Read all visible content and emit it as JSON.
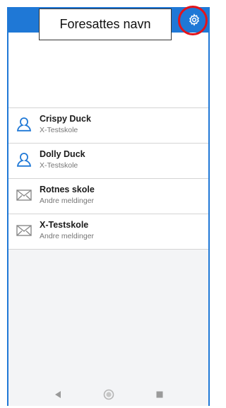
{
  "header": {
    "title": "Foresattes navn",
    "accent_color": "#1f78d6",
    "settings_icon": "gear-icon",
    "highlight_color": "#e3141b"
  },
  "conversations": [
    {
      "name": "Crispy Duck",
      "subtitle": "X-Testskole",
      "icon": "person-icon"
    },
    {
      "name": "Dolly Duck",
      "subtitle": "X-Testskole",
      "icon": "person-icon"
    },
    {
      "name": "Rotnes skole",
      "subtitle": "Andre meldinger",
      "icon": "envelope-icon"
    },
    {
      "name": "X-Testskole",
      "subtitle": "Andre meldinger",
      "icon": "envelope-icon"
    }
  ],
  "navigation": {
    "back_icon": "back-triangle-icon",
    "home_icon": "home-circle-icon",
    "recents_icon": "recents-square-icon"
  }
}
